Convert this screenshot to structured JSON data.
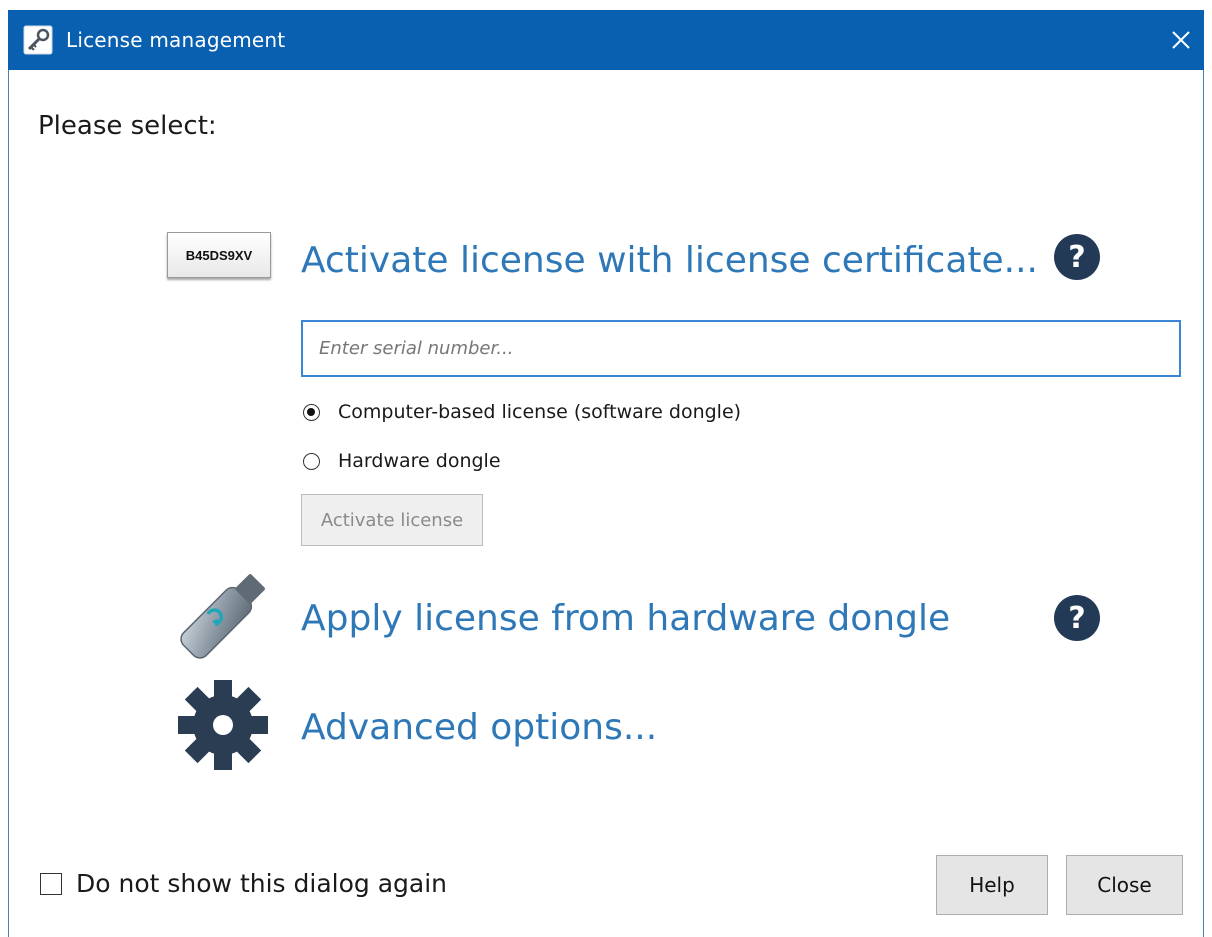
{
  "window": {
    "title": "License management"
  },
  "prompt": "Please select:",
  "certificate": {
    "badge_text": "B45DS9XV",
    "link": "Activate license with license certificate...",
    "help_glyph": "?",
    "serial_placeholder": "Enter serial number...",
    "options": [
      {
        "label": "Computer-based license (software dongle)",
        "checked": true
      },
      {
        "label": "Hardware dongle",
        "checked": false
      }
    ],
    "activate_label": "Activate license"
  },
  "dongle": {
    "link": "Apply license from hardware dongle",
    "help_glyph": "?"
  },
  "advanced": {
    "link": "Advanced options..."
  },
  "footer": {
    "dont_show_label": "Do not show this dialog again",
    "dont_show_checked": false,
    "help_label": "Help",
    "close_label": "Close"
  },
  "colors": {
    "titlebar": "#0a60b0",
    "link": "#2e78b8",
    "help_circle": "#233a57",
    "input_border": "#3a86d6"
  },
  "icons": {
    "app": "key-icon",
    "close": "close-icon",
    "dongle": "usb-dongle-icon",
    "advanced": "gear-icon",
    "help": "question-circle-icon"
  }
}
